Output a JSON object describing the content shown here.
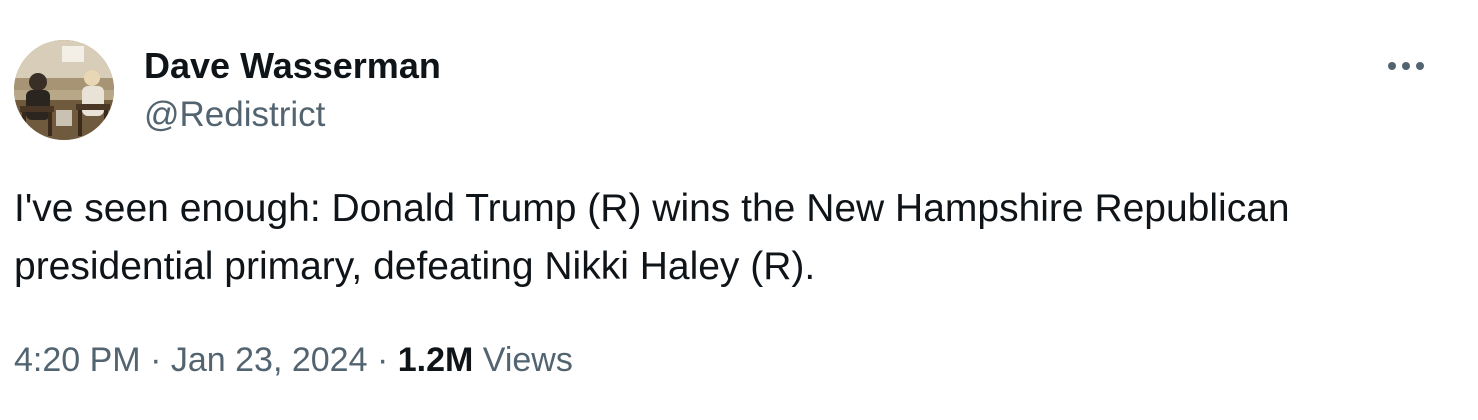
{
  "author": {
    "display_name": "Dave Wasserman",
    "handle": "@Redistrict",
    "avatar_icon": "profile-photo"
  },
  "more_icon": "more-horizontal-icon",
  "tweet": {
    "text": "I've seen enough: Donald Trump (R) wins the New Hampshire Republican presidential primary, defeating Nikki Haley (R)."
  },
  "meta": {
    "time": "4:20 PM",
    "separator": "·",
    "date": "Jan 23, 2024",
    "views_count": "1.2M",
    "views_label": "Views"
  },
  "colors": {
    "text_primary": "#0f1419",
    "text_secondary": "#536471",
    "background": "#ffffff"
  }
}
